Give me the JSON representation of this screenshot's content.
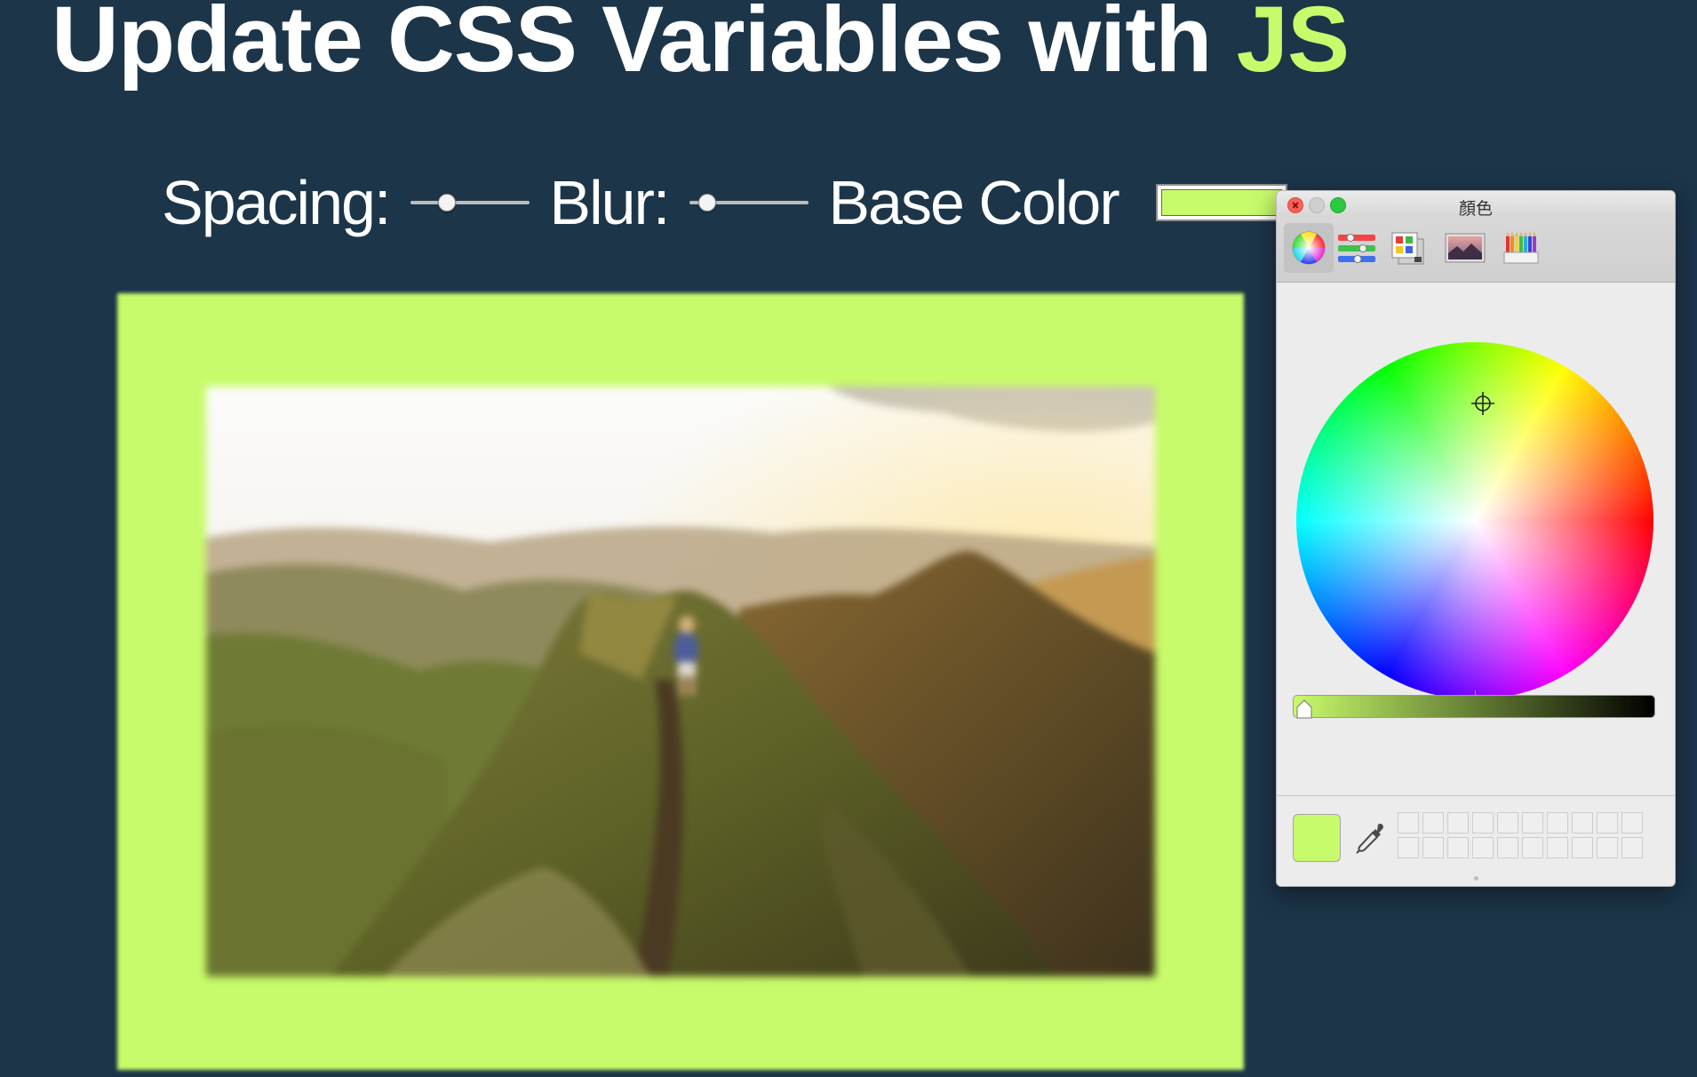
{
  "header": {
    "title_main": "Update CSS Variables with ",
    "title_highlight": "JS",
    "highlight_color": "#c8fb6b"
  },
  "controls": {
    "spacing_label": "Spacing:",
    "spacing_value_fraction": 0.3,
    "blur_label": "Blur:",
    "blur_value_fraction": 0.15,
    "base_color_label": "Base Color",
    "base_color": "#c8fb6b"
  },
  "page": {
    "background_color": "#1c3549",
    "frame_color": "#c8fb6b"
  },
  "color_picker": {
    "window_title": "顏色",
    "tools": [
      "color-wheel-icon",
      "color-sliders-icon",
      "color-palettes-icon",
      "image-palettes-icon",
      "pencils-icon"
    ],
    "active_tool": "color-wheel-icon",
    "selected_color": "#c8fb6b",
    "brightness_fraction": 0.0,
    "swatch_rows": 2,
    "swatch_columns": 10
  }
}
